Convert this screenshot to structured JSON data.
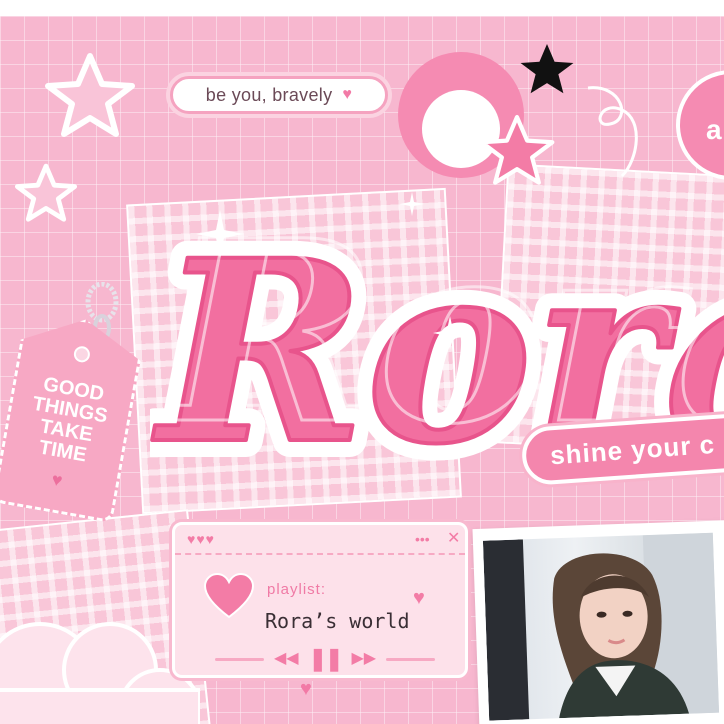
{
  "tagline": "be you, bravely",
  "title": "Rora",
  "corner_badge": "a",
  "shine_text": "shine your c",
  "tag": {
    "lines": [
      "GOOD",
      "THINGS",
      "TAKE",
      "TIME"
    ]
  },
  "player": {
    "label": "playlist:",
    "name": "Rora’s world",
    "window_hearts": "♥♥♥",
    "window_dots": "•••",
    "close_glyph": "✕",
    "prev_glyph": "◀◀",
    "pause_glyph": "❚❚",
    "next_glyph": "▶▶"
  },
  "colors": {
    "bg": "#f7b7cf",
    "accent": "#f486ad",
    "title_pink": "#f26fa0",
    "white": "#ffffff"
  },
  "icons": [
    "sparkle-star-icon",
    "black-star-icon",
    "heart-icon",
    "chain-icon",
    "cloud-icon"
  ]
}
